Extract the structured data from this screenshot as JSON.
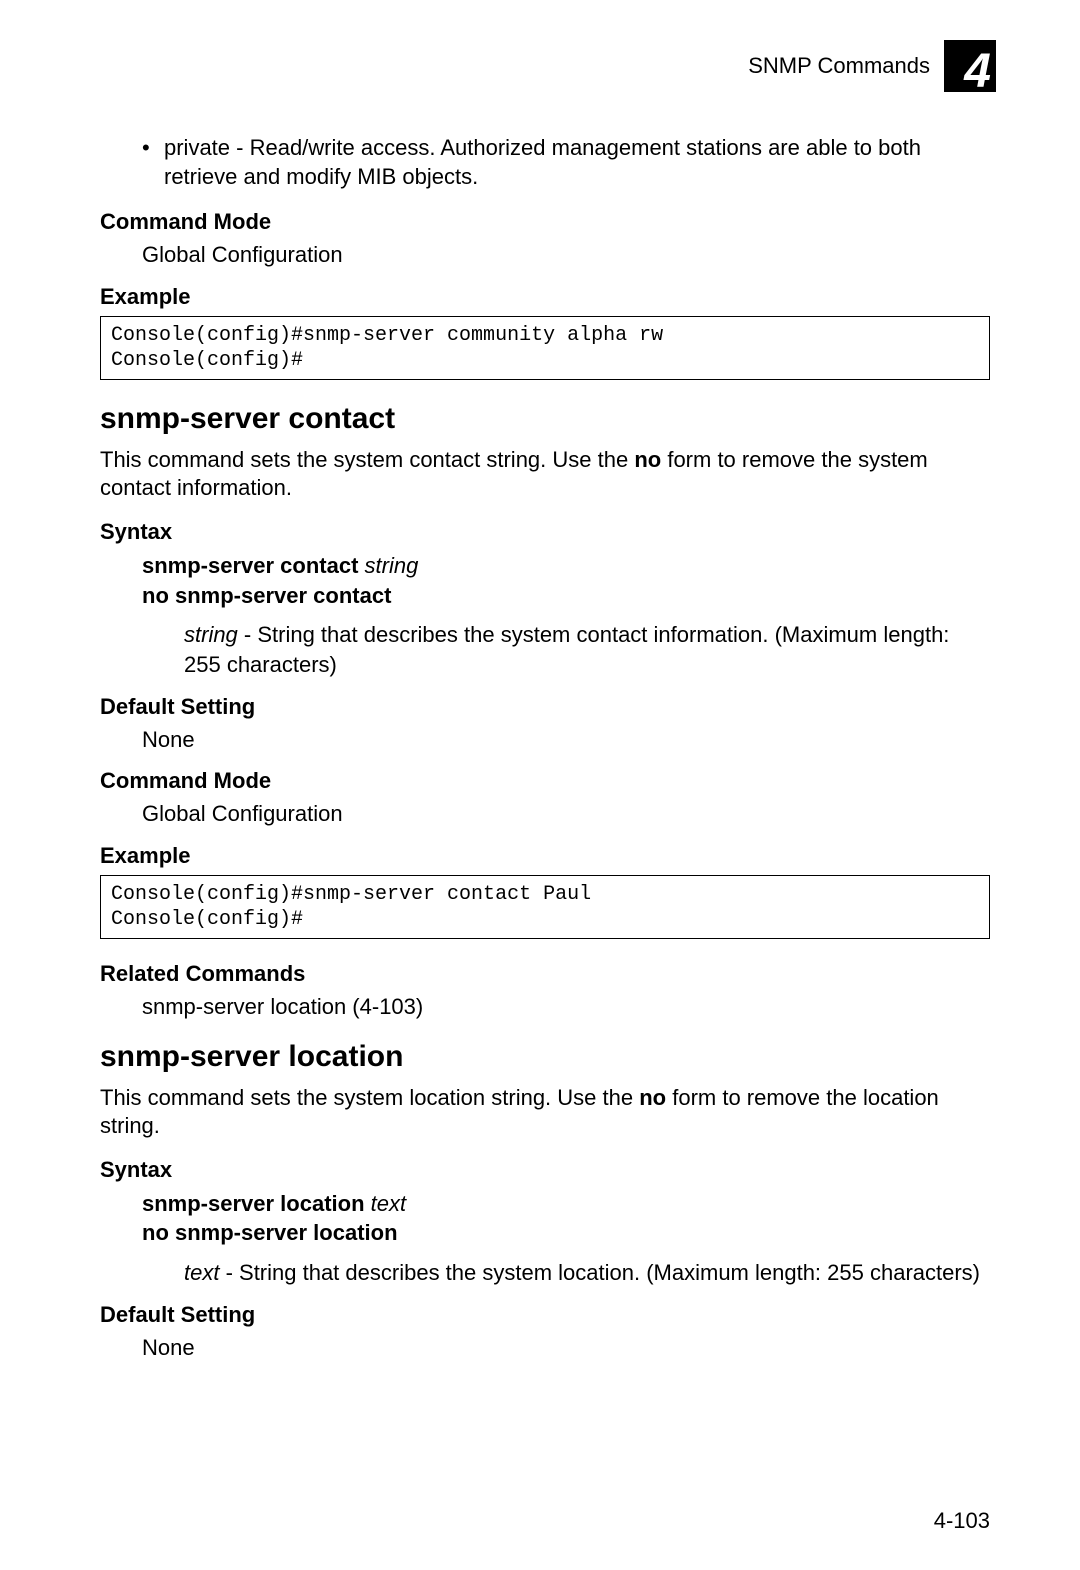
{
  "header": {
    "breadcrumb": "SNMP Commands",
    "chapter_number": "4"
  },
  "intro_bullet": "private - Read/write access. Authorized management stations are able to both retrieve and modify MIB objects.",
  "labels": {
    "command_mode": "Command Mode",
    "example": "Example",
    "syntax": "Syntax",
    "default_setting": "Default Setting",
    "related_commands": "Related Commands"
  },
  "shared": {
    "global_configuration": "Global Configuration",
    "none": "None"
  },
  "example1_code": "Console(config)#snmp-server community alpha rw\nConsole(config)#",
  "cmd_contact": {
    "title": "snmp-server contact",
    "desc_prefix": "This command sets the system contact string. Use the ",
    "desc_bold": "no",
    "desc_suffix": " form to remove the system contact information.",
    "syntax_cmd": "snmp-server contact",
    "syntax_arg": "string",
    "syntax_no": "no snmp-server contact",
    "param_name": "string",
    "param_desc": " - String that describes the system contact information. (Maximum length: 255 characters)",
    "example_code": "Console(config)#snmp-server contact Paul\nConsole(config)#",
    "related": "snmp-server location (4-103)"
  },
  "cmd_location": {
    "title": "snmp-server location",
    "desc_prefix": "This command sets the system location string. Use the ",
    "desc_bold": "no",
    "desc_suffix": " form to remove the location string.",
    "syntax_cmd": "snmp-server location",
    "syntax_arg": "text",
    "syntax_no": "no snmp-server location",
    "param_name": "text",
    "param_desc": " - String that describes the system location. (Maximum length: 255 characters)"
  },
  "page_number": "4-103"
}
